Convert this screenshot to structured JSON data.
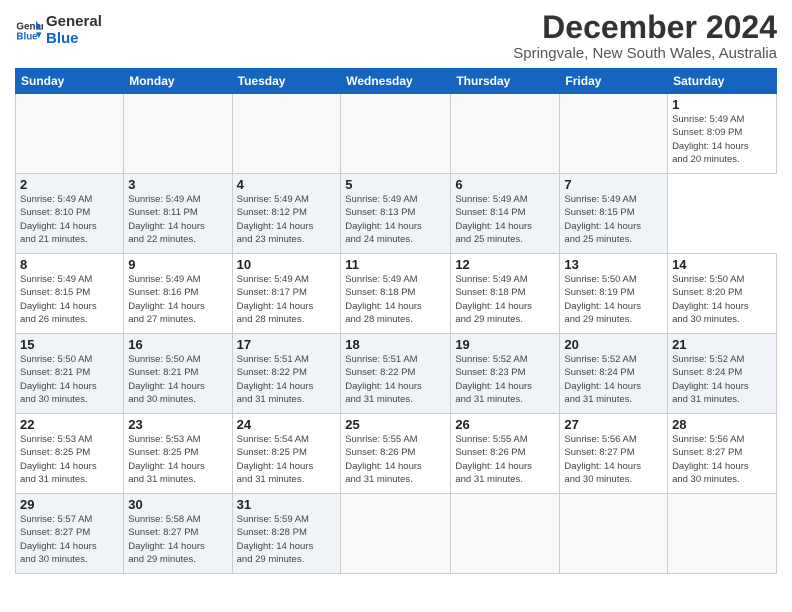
{
  "header": {
    "logo_line1": "General",
    "logo_line2": "Blue",
    "title": "December 2024",
    "subtitle": "Springvale, New South Wales, Australia"
  },
  "calendar": {
    "headers": [
      "Sunday",
      "Monday",
      "Tuesday",
      "Wednesday",
      "Thursday",
      "Friday",
      "Saturday"
    ],
    "weeks": [
      [
        {
          "day": "",
          "info": ""
        },
        {
          "day": "",
          "info": ""
        },
        {
          "day": "",
          "info": ""
        },
        {
          "day": "",
          "info": ""
        },
        {
          "day": "",
          "info": ""
        },
        {
          "day": "",
          "info": ""
        },
        {
          "day": "1",
          "info": "Sunrise: 5:49 AM\nSunset: 8:09 PM\nDaylight: 14 hours\nand 20 minutes."
        }
      ],
      [
        {
          "day": "2",
          "info": "Sunrise: 5:49 AM\nSunset: 8:10 PM\nDaylight: 14 hours\nand 21 minutes."
        },
        {
          "day": "3",
          "info": "Sunrise: 5:49 AM\nSunset: 8:11 PM\nDaylight: 14 hours\nand 22 minutes."
        },
        {
          "day": "4",
          "info": "Sunrise: 5:49 AM\nSunset: 8:12 PM\nDaylight: 14 hours\nand 23 minutes."
        },
        {
          "day": "5",
          "info": "Sunrise: 5:49 AM\nSunset: 8:13 PM\nDaylight: 14 hours\nand 24 minutes."
        },
        {
          "day": "6",
          "info": "Sunrise: 5:49 AM\nSunset: 8:14 PM\nDaylight: 14 hours\nand 25 minutes."
        },
        {
          "day": "7",
          "info": "Sunrise: 5:49 AM\nSunset: 8:15 PM\nDaylight: 14 hours\nand 25 minutes."
        }
      ],
      [
        {
          "day": "8",
          "info": "Sunrise: 5:49 AM\nSunset: 8:15 PM\nDaylight: 14 hours\nand 26 minutes."
        },
        {
          "day": "9",
          "info": "Sunrise: 5:49 AM\nSunset: 8:16 PM\nDaylight: 14 hours\nand 27 minutes."
        },
        {
          "day": "10",
          "info": "Sunrise: 5:49 AM\nSunset: 8:17 PM\nDaylight: 14 hours\nand 28 minutes."
        },
        {
          "day": "11",
          "info": "Sunrise: 5:49 AM\nSunset: 8:18 PM\nDaylight: 14 hours\nand 28 minutes."
        },
        {
          "day": "12",
          "info": "Sunrise: 5:49 AM\nSunset: 8:18 PM\nDaylight: 14 hours\nand 29 minutes."
        },
        {
          "day": "13",
          "info": "Sunrise: 5:50 AM\nSunset: 8:19 PM\nDaylight: 14 hours\nand 29 minutes."
        },
        {
          "day": "14",
          "info": "Sunrise: 5:50 AM\nSunset: 8:20 PM\nDaylight: 14 hours\nand 30 minutes."
        }
      ],
      [
        {
          "day": "15",
          "info": "Sunrise: 5:50 AM\nSunset: 8:21 PM\nDaylight: 14 hours\nand 30 minutes."
        },
        {
          "day": "16",
          "info": "Sunrise: 5:50 AM\nSunset: 8:21 PM\nDaylight: 14 hours\nand 30 minutes."
        },
        {
          "day": "17",
          "info": "Sunrise: 5:51 AM\nSunset: 8:22 PM\nDaylight: 14 hours\nand 31 minutes."
        },
        {
          "day": "18",
          "info": "Sunrise: 5:51 AM\nSunset: 8:22 PM\nDaylight: 14 hours\nand 31 minutes."
        },
        {
          "day": "19",
          "info": "Sunrise: 5:52 AM\nSunset: 8:23 PM\nDaylight: 14 hours\nand 31 minutes."
        },
        {
          "day": "20",
          "info": "Sunrise: 5:52 AM\nSunset: 8:24 PM\nDaylight: 14 hours\nand 31 minutes."
        },
        {
          "day": "21",
          "info": "Sunrise: 5:52 AM\nSunset: 8:24 PM\nDaylight: 14 hours\nand 31 minutes."
        }
      ],
      [
        {
          "day": "22",
          "info": "Sunrise: 5:53 AM\nSunset: 8:25 PM\nDaylight: 14 hours\nand 31 minutes."
        },
        {
          "day": "23",
          "info": "Sunrise: 5:53 AM\nSunset: 8:25 PM\nDaylight: 14 hours\nand 31 minutes."
        },
        {
          "day": "24",
          "info": "Sunrise: 5:54 AM\nSunset: 8:25 PM\nDaylight: 14 hours\nand 31 minutes."
        },
        {
          "day": "25",
          "info": "Sunrise: 5:55 AM\nSunset: 8:26 PM\nDaylight: 14 hours\nand 31 minutes."
        },
        {
          "day": "26",
          "info": "Sunrise: 5:55 AM\nSunset: 8:26 PM\nDaylight: 14 hours\nand 31 minutes."
        },
        {
          "day": "27",
          "info": "Sunrise: 5:56 AM\nSunset: 8:27 PM\nDaylight: 14 hours\nand 30 minutes."
        },
        {
          "day": "28",
          "info": "Sunrise: 5:56 AM\nSunset: 8:27 PM\nDaylight: 14 hours\nand 30 minutes."
        }
      ],
      [
        {
          "day": "29",
          "info": "Sunrise: 5:57 AM\nSunset: 8:27 PM\nDaylight: 14 hours\nand 30 minutes."
        },
        {
          "day": "30",
          "info": "Sunrise: 5:58 AM\nSunset: 8:27 PM\nDaylight: 14 hours\nand 29 minutes."
        },
        {
          "day": "31",
          "info": "Sunrise: 5:59 AM\nSunset: 8:28 PM\nDaylight: 14 hours\nand 29 minutes."
        },
        {
          "day": "",
          "info": ""
        },
        {
          "day": "",
          "info": ""
        },
        {
          "day": "",
          "info": ""
        },
        {
          "day": "",
          "info": ""
        }
      ]
    ]
  }
}
